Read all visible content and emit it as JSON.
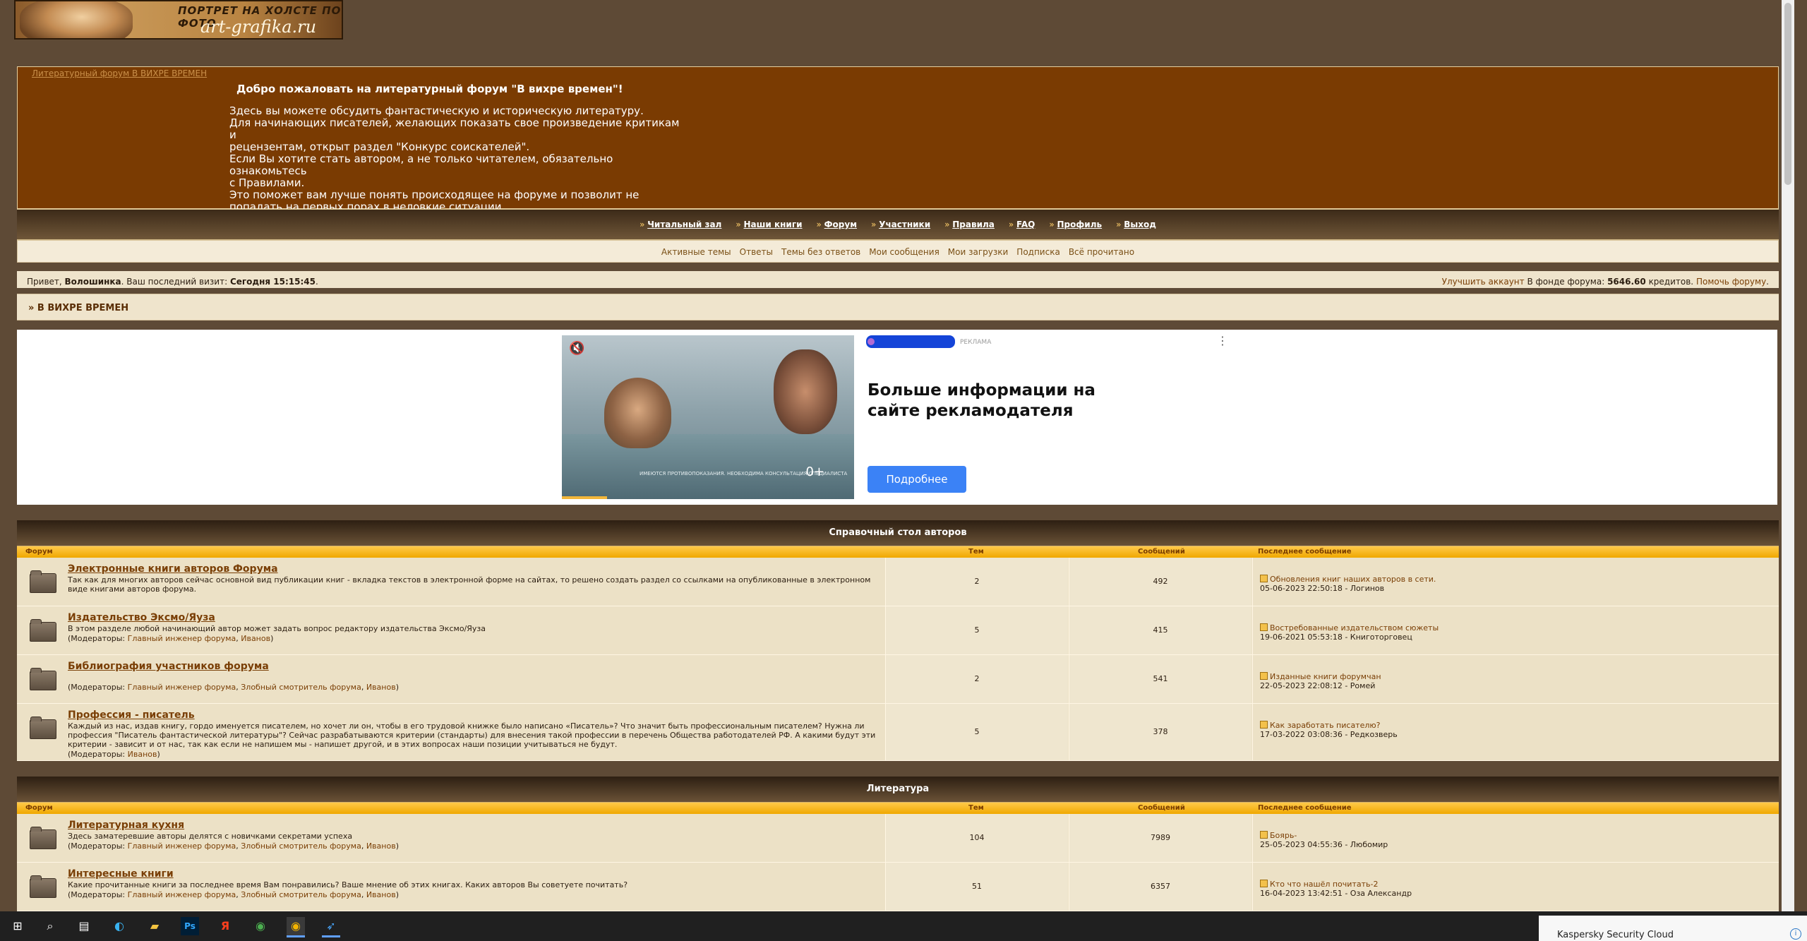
{
  "banner": {
    "line1": "ПОРТРЕТ НА ХОЛСТЕ ПО ФОТО",
    "line2": "art-grafika.ru"
  },
  "header": {
    "logo_alt": "Литературный форум В ВИХРЕ ВРЕМЕН",
    "welcome": "Добро пожаловать на литературный форум \"В вихре времен\"!",
    "desc": [
      "Здесь вы можете обсудить фантастическую и историческую литературу.",
      "Для начинающих писателей, желающих показать свое произведение критикам и",
      "рецензентам, открыт раздел \"Конкурс соискателей\".",
      "Если Вы хотите стать автором, а не только читателем, обязательно ознакомьтесь",
      "с Правилами.",
      "Это поможет вам лучше понять происходящее на форуме и позволит не",
      "попадать на первых порах в неловкие ситуации."
    ]
  },
  "nav": [
    {
      "label": "Читальный зал"
    },
    {
      "label": "Наши книги"
    },
    {
      "label": "Форум"
    },
    {
      "label": "Участники"
    },
    {
      "label": "Правила"
    },
    {
      "label": "FAQ"
    },
    {
      "label": "Профиль"
    },
    {
      "label": "Выход"
    }
  ],
  "subnav": [
    "Активные темы",
    "Ответы",
    "Темы без ответов",
    "Мои сообщения",
    "Мои загрузки",
    "Подписка",
    "Всё прочитано"
  ],
  "info": {
    "greeting": "Привет,",
    "user": "Волошинка",
    "last_visit_label": ". Ваш последний визит:",
    "last_visit": "Сегодня 15:15:45",
    "upgrade": "Улучшить аккаунт",
    "fund_label": "В фонде форума:",
    "fund_value": "5646.60",
    "fund_unit": "кредитов.",
    "help": "Помочь форуму"
  },
  "breadcrumb": "» В ВИХРЕ ВРЕМЕН",
  "ad": {
    "label": "РЕКЛАМА",
    "age": "0+",
    "tiny": "ИМЕЮТСЯ ПРОТИВОПОКАЗАНИЯ. НЕОБХОДИМА КОНСУЛЬТАЦИЯ СПЕЦИАЛИСТА",
    "headline": "Больше информации на сайте рекламодателя",
    "cta": "Подробнее"
  },
  "columns": {
    "forum": "Форум",
    "topics": "Тем",
    "posts": "Сообщений",
    "last": "Последнее сообщение"
  },
  "moderators_label": "(Модераторы:",
  "categories": [
    {
      "title": "Справочный стол авторов",
      "forums": [
        {
          "title": "Электронные книги авторов Форума",
          "desc": "Так как для многих авторов сейчас основной вид публикации книг - вкладка текстов в электронной форме на сайтах, то решено создать раздел со ссылками на опубликованные в электронном виде книгами авторов форума.",
          "mods": [],
          "topics": "2",
          "posts": "492",
          "last_title": "Обновления книг наших авторов в сети.",
          "last_meta": "05-06-2023 22:50:18 - Логинов"
        },
        {
          "title": "Издательство Эксмо/Яуза",
          "desc": "В этом разделе любой начинающий автор может задать вопрос редактору издательства Эксмо/Яуза",
          "mods": [
            "Главный инженер форума",
            "Иванов"
          ],
          "topics": "5",
          "posts": "415",
          "last_title": "Востребованные издательством сюжеты",
          "last_meta": "19-06-2021 05:53:18 - Книготорговец"
        },
        {
          "title": "Библиография участников форума",
          "desc": "",
          "mods": [
            "Главный инженер форума",
            "Злобный смотритель форума",
            "Иванов"
          ],
          "topics": "2",
          "posts": "541",
          "last_title": "Изданные книги форумчан",
          "last_meta": "22-05-2023 22:08:12 - Ромей"
        },
        {
          "title": "Профессия - писатель",
          "desc": "Каждый из нас, издав книгу, гордо именуется писателем, но хочет ли он, чтобы в его трудовой книжке было написано «Писатель»? Что значит быть профессиональным писателем? Нужна ли профессия \"Писатель фантастической литературы\"? Сейчас разрабатываются критерии (стандарты) для внесения такой профессии в перечень Общества работодателей РФ. А какими будут эти критерии - зависит и от нас, так как если не напишем мы - напишет другой, и в этих вопросах наши позиции учитываться не будут.",
          "mods": [
            "Иванов"
          ],
          "topics": "5",
          "posts": "378",
          "last_title": "Как заработать писателю?",
          "last_meta": "17-03-2022 03:08:36 - Редкозверь"
        }
      ]
    },
    {
      "title": "Литература",
      "forums": [
        {
          "title": "Литературная кухня",
          "desc": "Здесь заматеревшие авторы делятся с новичками секретами успеха",
          "mods": [
            "Главный инженер форума",
            "Злобный смотритель форума",
            "Иванов"
          ],
          "topics": "104",
          "posts": "7989",
          "last_title": "Боярь-",
          "last_meta": "25-05-2023 04:55:36 - Любомир"
        },
        {
          "title": "Интересные книги",
          "desc": "Какие прочитанные книги за последнее время Вам понравились? Ваше мнение об этих книгах. Каких авторов Вы советуете почитать?",
          "mods": [
            "Главный инженер форума",
            "Злобный смотритель форума",
            "Иванов"
          ],
          "topics": "51",
          "posts": "6357",
          "last_title": "Кто что нашёл почитать-2",
          "last_meta": "16-04-2023 13:42:51 - Оза Александр"
        }
      ]
    }
  ],
  "taskbar": {
    "icons": [
      "windows-icon",
      "search-icon",
      "task-view-icon",
      "edge-icon",
      "explorer-icon",
      "photoshop-icon",
      "yandex-icon",
      "chrome-icon",
      "chrome-active-icon",
      "app-icon"
    ],
    "ps_label": "Ps",
    "yandex_label": "Я"
  },
  "notification": {
    "title": "Kaspersky Security Cloud",
    "info": "i"
  }
}
